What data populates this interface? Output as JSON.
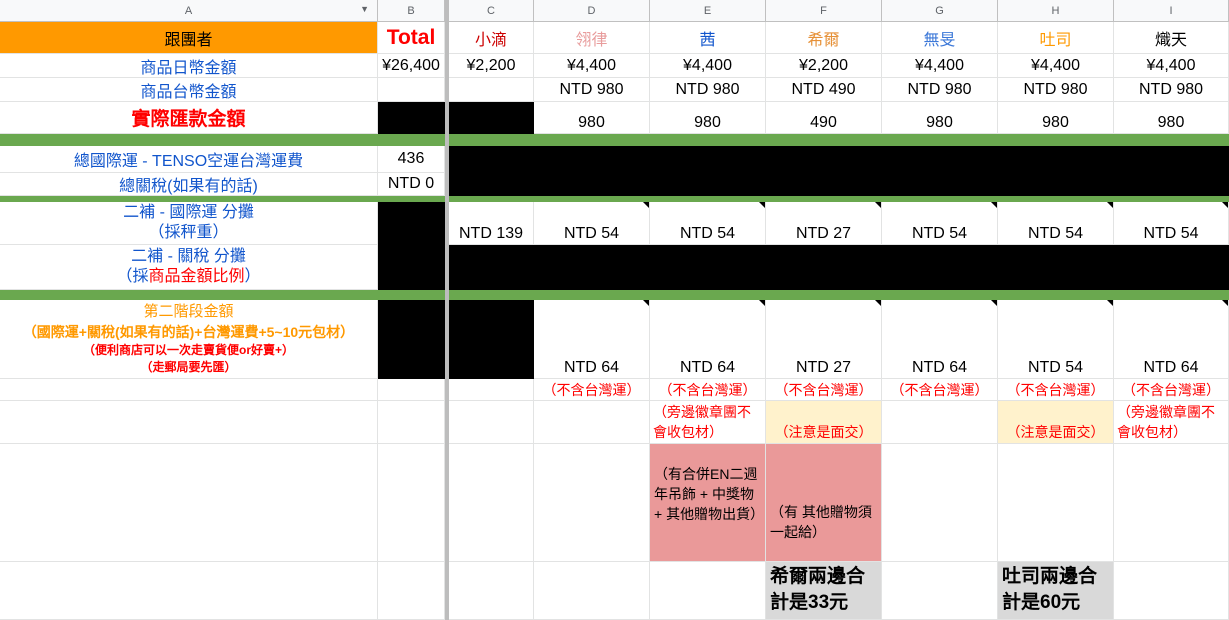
{
  "columns": {
    "A": "A",
    "B": "B",
    "C": "C",
    "D": "D",
    "E": "E",
    "F": "F",
    "G": "G",
    "H": "H",
    "I": "I"
  },
  "labels": {
    "follower": "跟團者",
    "total": "Total",
    "jpy_amount": "商品日幣金額",
    "twd_amount": "商品台幣金額",
    "actual_remit": "實際匯款金額",
    "intl_shipping": "總國際運 - TENSO空運台灣運費",
    "customs": "總關稅(如果有的話)",
    "supp_ship_1": "二補 - 國際運 分攤",
    "supp_ship_2": "（採秤重）",
    "supp_tax_1": "二補 - 關稅 分攤",
    "supp_tax_2_pre": "（採",
    "supp_tax_2_red": "商品金額比例",
    "supp_tax_2_post": "）",
    "stage2_1": "第二階段金額",
    "stage2_2": "（國際運+關稅(如果有的話)+台灣運費+5~10元包材）",
    "stage2_3": "（便利商店可以一次走賣貨便or好賣+）",
    "stage2_4": "（走郵局要先匯）"
  },
  "total_col": {
    "jpy": "¥26,400",
    "intl_shipping": "436",
    "customs": "NTD 0"
  },
  "members": [
    {
      "name": "小滴",
      "color": "#cc0000",
      "jpy": "¥2,200",
      "twd": "",
      "remit": "",
      "supp_ship": "NTD 139",
      "stage2": "",
      "note1": "",
      "note2": "",
      "note3": "",
      "summary": ""
    },
    {
      "name": "翎律",
      "color": "#e89c9c",
      "jpy": "¥4,400",
      "twd": "NTD 980",
      "remit": "980",
      "supp_ship": "NTD 54",
      "stage2": "NTD 64",
      "note1": "（不含台灣運）",
      "note2": "",
      "note3": "",
      "summary": ""
    },
    {
      "name": "茜",
      "color": "#1155cc",
      "jpy": "¥4,400",
      "twd": "NTD 980",
      "remit": "980",
      "supp_ship": "NTD 54",
      "stage2": "NTD 64",
      "note1": "（不含台灣運）",
      "note2": "（旁邊徽章團不會收包材）",
      "note3": "（有合併EN二週年吊飾 + 中獎物 + 其他贈物出貨）",
      "summary": ""
    },
    {
      "name": "希爾",
      "color": "#e69138",
      "jpy": "¥2,200",
      "twd": "NTD 490",
      "remit": "490",
      "supp_ship": "NTD 27",
      "stage2": "NTD 27",
      "note1": "（不含台灣運）",
      "note2": "（注意是面交）",
      "note3": "（有 其他贈物須一起給）",
      "summary": "希爾兩邊合計是33元"
    },
    {
      "name": "無旻",
      "color": "#3c78d8",
      "jpy": "¥4,400",
      "twd": "NTD 980",
      "remit": "980",
      "supp_ship": "NTD 54",
      "stage2": "NTD 64",
      "note1": "（不含台灣運）",
      "note2": "",
      "note3": "",
      "summary": ""
    },
    {
      "name": "吐司",
      "color": "#ff9900",
      "jpy": "¥4,400",
      "twd": "NTD 980",
      "remit": "980",
      "supp_ship": "NTD 54",
      "stage2": "NTD 54",
      "note1": "（不含台灣運）",
      "note2": "（注意是面交）",
      "note3": "",
      "summary": "吐司兩邊合計是60元"
    },
    {
      "name": "熾天",
      "color": "#000000",
      "jpy": "¥4,400",
      "twd": "NTD 980",
      "remit": "980",
      "supp_ship": "NTD 54",
      "stage2": "NTD 64",
      "note1": "（不含台灣運）",
      "note2": "（旁邊徽章團不會收包材）",
      "note3": "",
      "summary": ""
    }
  ],
  "colors": {
    "header_orange": "#ff9900",
    "band_green": "#6aa84f",
    "note_pink": "#ea9999",
    "note_cream": "#fff2cc",
    "summary_grey": "#d9d9d9",
    "label_blue": "#1155cc"
  }
}
